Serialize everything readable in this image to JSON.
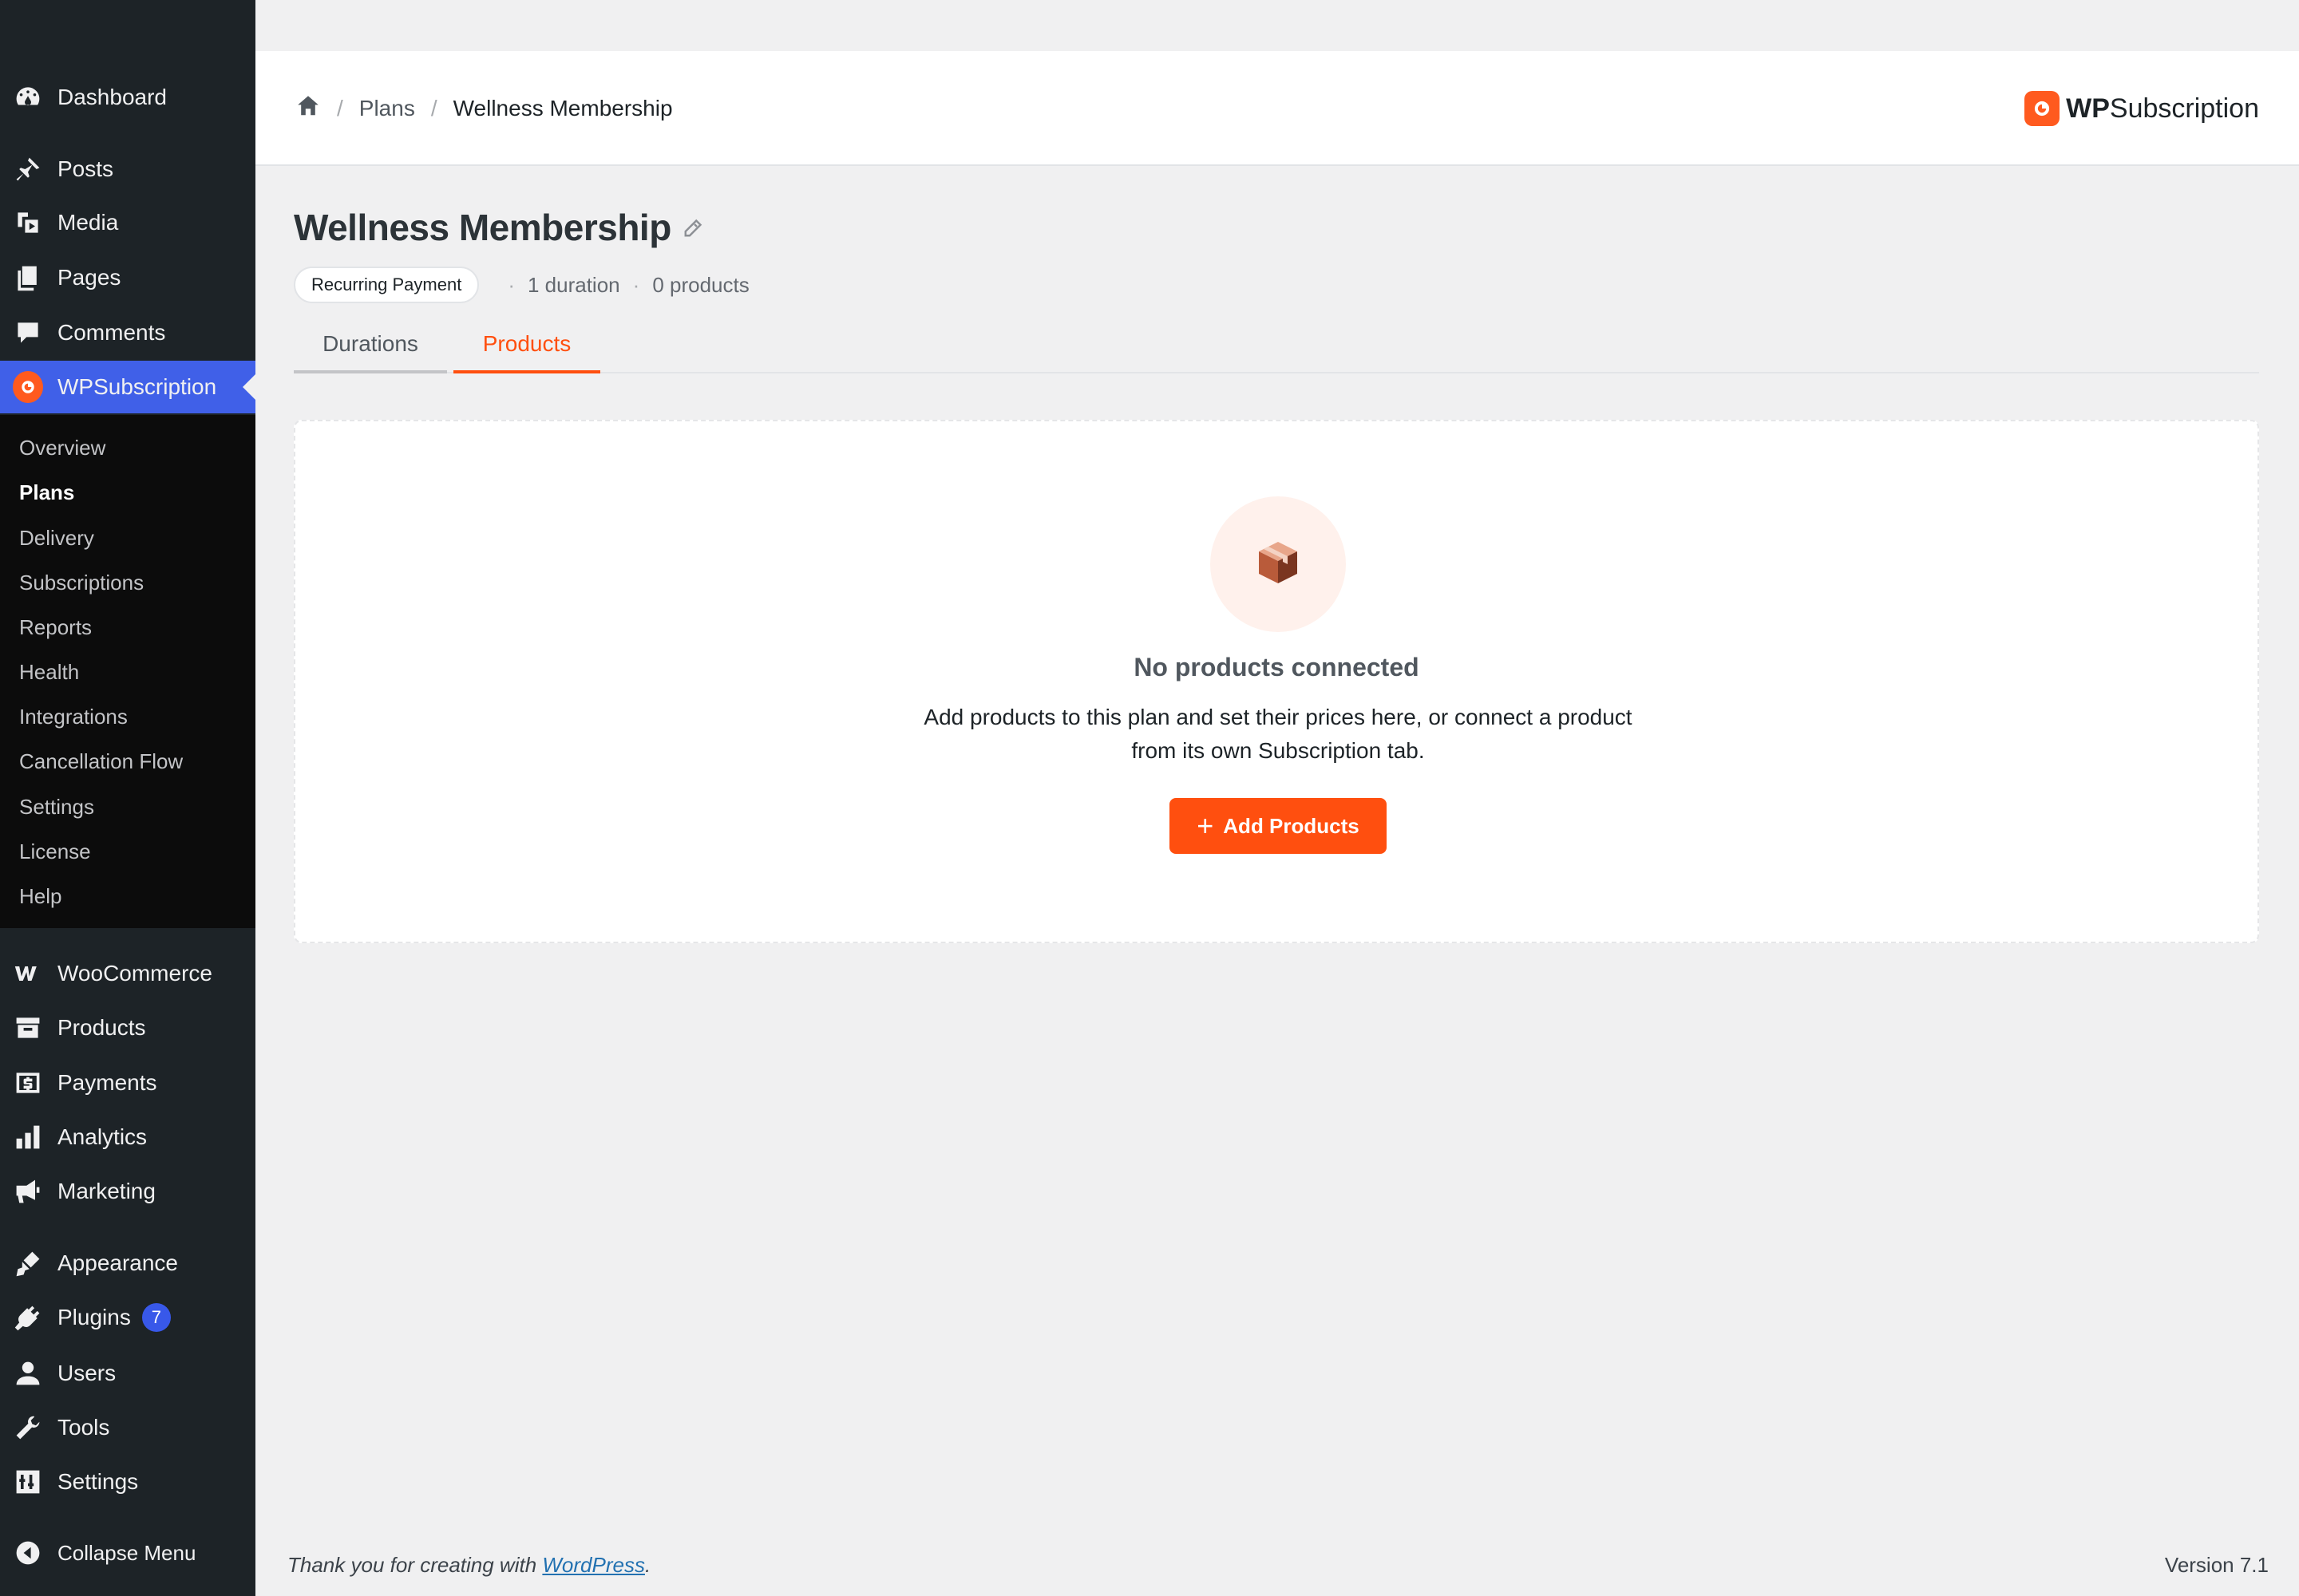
{
  "sidebar": {
    "top_items": [
      {
        "label": "Dashboard",
        "icon": "dashboard-icon"
      },
      {
        "label": "Posts",
        "icon": "pin-icon"
      },
      {
        "label": "Media",
        "icon": "media-icon"
      },
      {
        "label": "Pages",
        "icon": "pages-icon"
      },
      {
        "label": "Comments",
        "icon": "comment-icon"
      },
      {
        "label": "WPSubscription",
        "icon": "wpsubscription-icon"
      }
    ],
    "submenu": [
      "Overview",
      "Plans",
      "Delivery",
      "Subscriptions",
      "Reports",
      "Health",
      "Integrations",
      "Cancellation Flow",
      "Settings",
      "License",
      "Help"
    ],
    "bottom_items": [
      {
        "label": "WooCommerce",
        "icon": "woocommerce-icon"
      },
      {
        "label": "Products",
        "icon": "archive-icon"
      },
      {
        "label": "Payments",
        "icon": "dollar-icon"
      },
      {
        "label": "Analytics",
        "icon": "bar-chart-icon"
      },
      {
        "label": "Marketing",
        "icon": "megaphone-icon"
      },
      {
        "label": "Appearance",
        "icon": "paintbrush-icon"
      },
      {
        "label": "Plugins",
        "icon": "plug-icon",
        "badge": "7"
      },
      {
        "label": "Users",
        "icon": "user-icon"
      },
      {
        "label": "Tools",
        "icon": "wrench-icon"
      },
      {
        "label": "Settings",
        "icon": "sliders-icon"
      },
      {
        "label": "Collapse Menu",
        "icon": "collapse-icon"
      }
    ],
    "active_color": "#4060e8"
  },
  "header": {
    "breadcrumb": {
      "parent": "Plans",
      "current": "Wellness Membership"
    },
    "brand_bold": "WP",
    "brand_rest": "Subscription"
  },
  "plan": {
    "title": "Wellness Membership",
    "payment_type": "Recurring Payment",
    "duration_count": "1 duration",
    "product_count": "0 products"
  },
  "tabs": {
    "durations": "Durations",
    "products": "Products",
    "active": "Products"
  },
  "empty_state": {
    "title": "No products connected",
    "description": "Add products to this plan and set their prices here, or connect a product from its own Subscription tab.",
    "button_label": "Add Products"
  },
  "footer": {
    "thanks_prefix": "Thank you for creating with ",
    "thanks_link": "WordPress",
    "thanks_suffix": ".",
    "version": "Version 7.1"
  },
  "colors": {
    "accent": "#ff4f0f",
    "sidebar_bg": "#1d2327"
  }
}
